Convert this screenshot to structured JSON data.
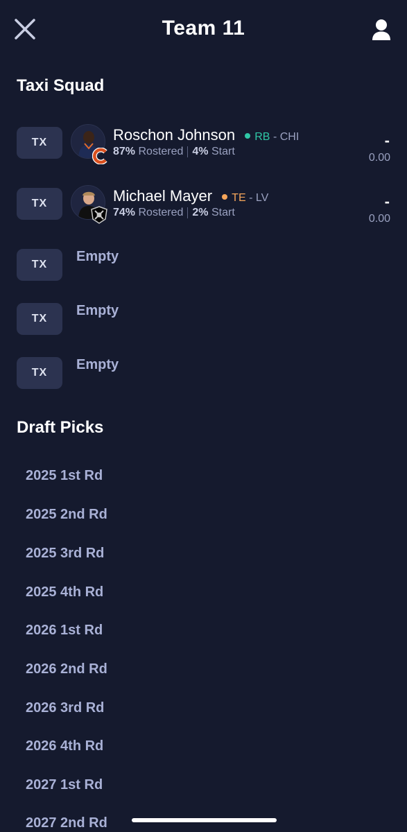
{
  "header": {
    "title": "Team 11",
    "close_icon": "close-icon",
    "profile_icon": "user-icon"
  },
  "taxi_squad": {
    "title": "Taxi Squad",
    "slots": [
      {
        "badge": "TX",
        "player": {
          "name": "Roschon Johnson",
          "position": "RB",
          "team": "- CHI",
          "position_color": "#2fc7a6",
          "rostered_pct": "87%",
          "rostered_label": "Rostered",
          "start_pct": "4%",
          "start_label": "Start",
          "score_dash": "-",
          "score": "0.00",
          "team_logo": "chicago-bears-logo"
        }
      },
      {
        "badge": "TX",
        "player": {
          "name": "Michael Mayer",
          "position": "TE",
          "team": "- LV",
          "position_color": "#f5a55a",
          "rostered_pct": "74%",
          "rostered_label": "Rostered",
          "start_pct": "2%",
          "start_label": "Start",
          "score_dash": "-",
          "score": "0.00",
          "team_logo": "las-vegas-raiders-logo"
        }
      },
      {
        "badge": "TX",
        "empty_label": "Empty"
      },
      {
        "badge": "TX",
        "empty_label": "Empty"
      },
      {
        "badge": "TX",
        "empty_label": "Empty"
      }
    ]
  },
  "draft_picks": {
    "title": "Draft Picks",
    "items": [
      "2025 1st Rd",
      "2025 2nd Rd",
      "2025 3rd Rd",
      "2025 4th Rd",
      "2026 1st Rd",
      "2026 2nd Rd",
      "2026 3rd Rd",
      "2026 4th Rd",
      "2027 1st Rd",
      "2027 2nd Rd"
    ]
  },
  "colors": {
    "background": "#151a2e",
    "badge_bg": "#2c3350",
    "muted_text": "#9aa1c0",
    "link_text": "#a9b1d6"
  }
}
